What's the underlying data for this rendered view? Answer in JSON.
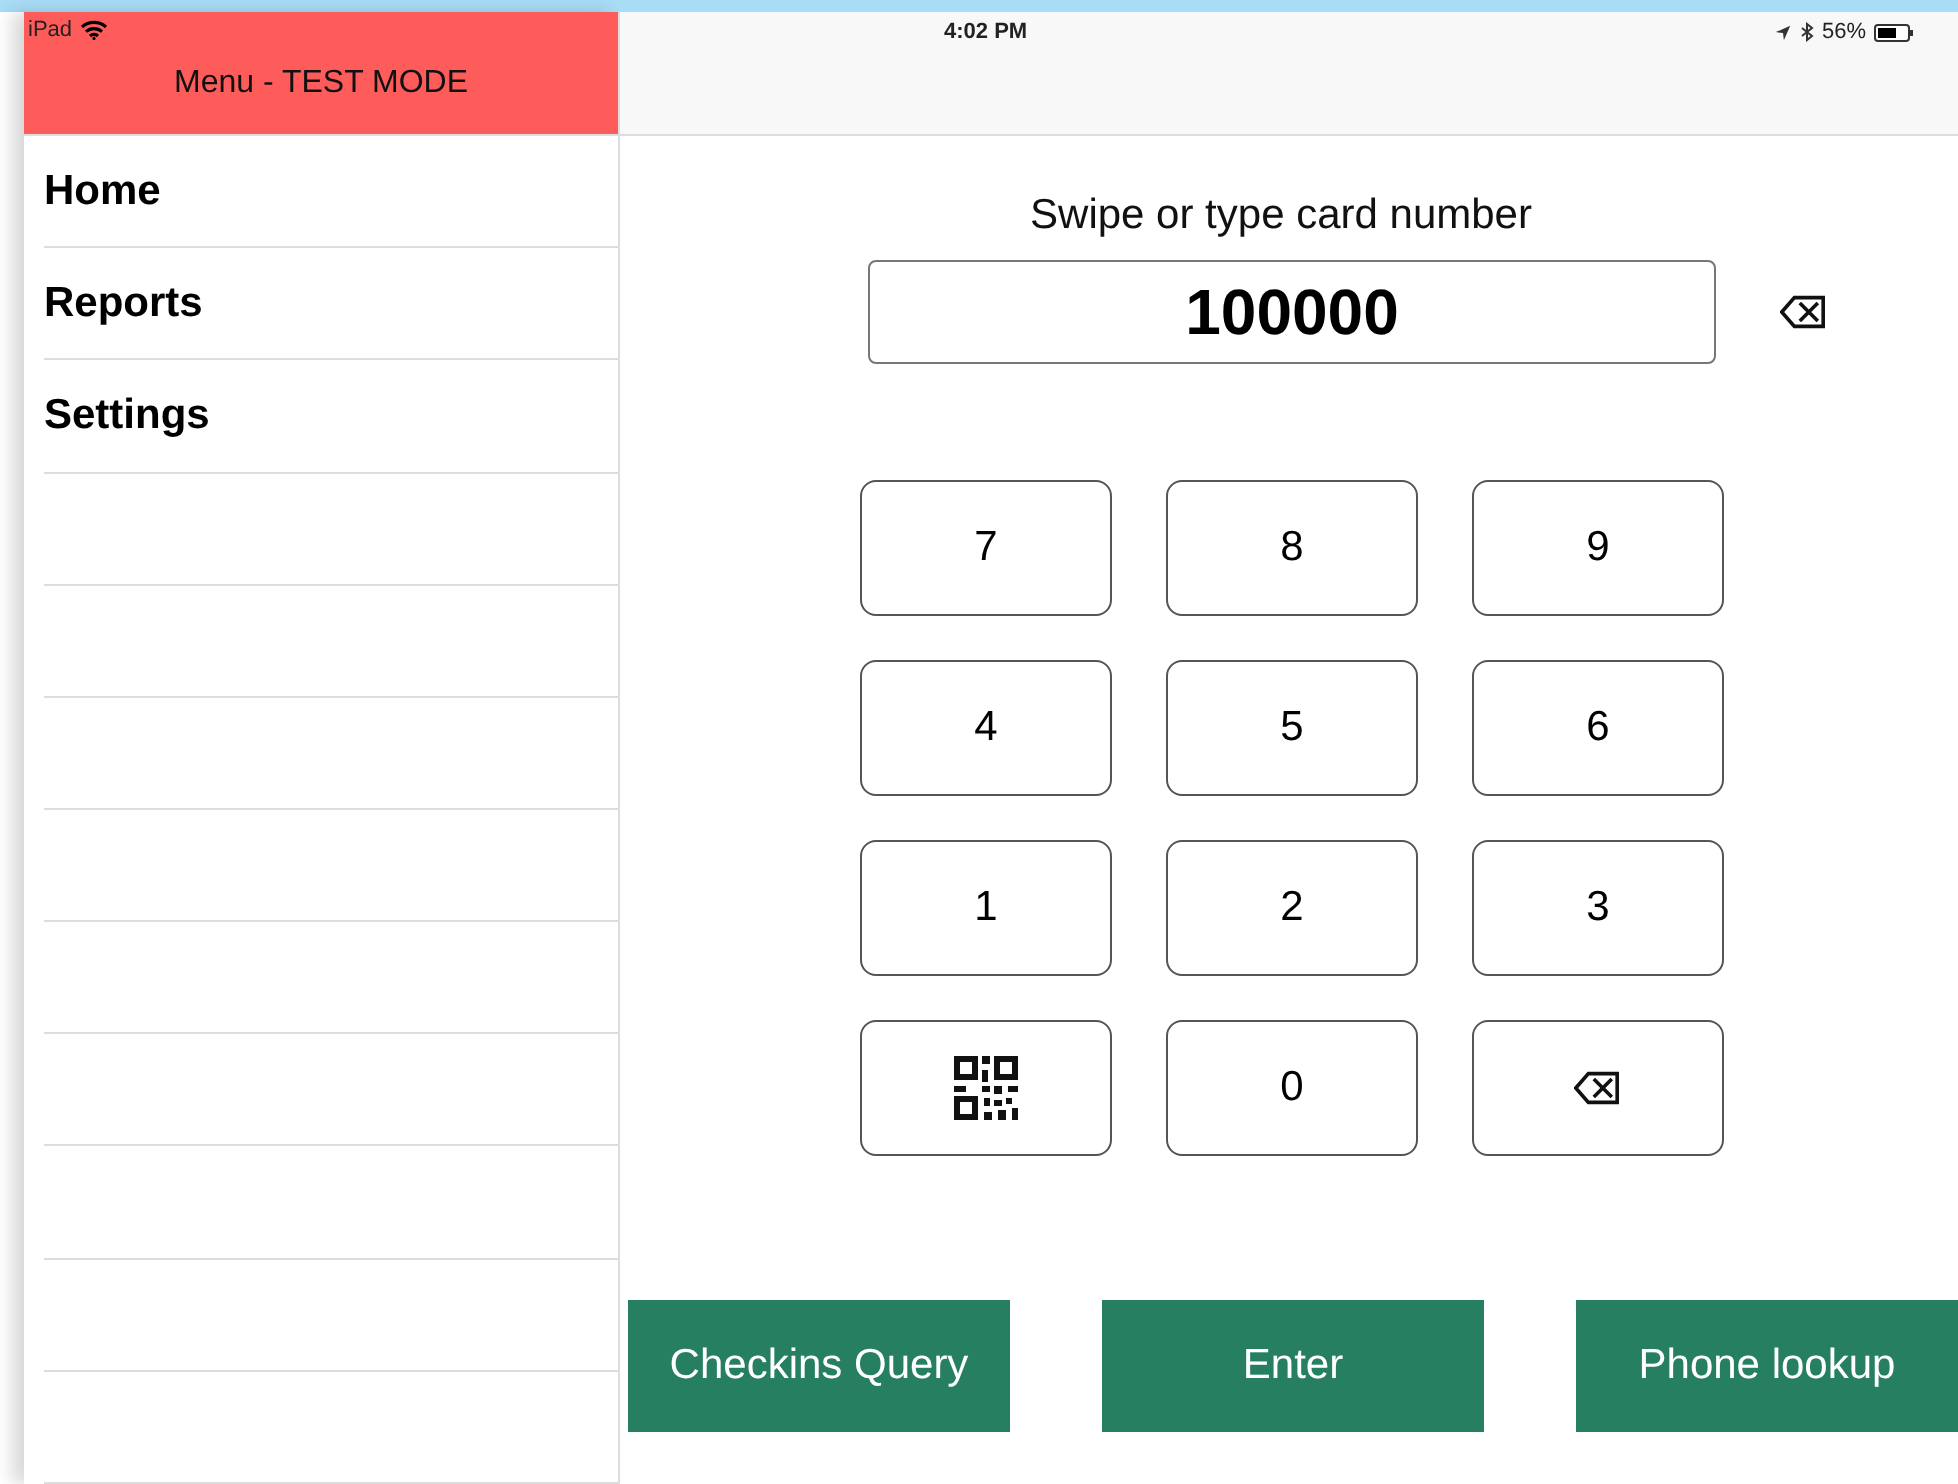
{
  "status_bar": {
    "device": "iPad",
    "time": "4:02 PM",
    "battery": "56%"
  },
  "sidebar": {
    "title": "Menu - TEST MODE",
    "items": [
      {
        "label": "Home"
      },
      {
        "label": "Reports"
      },
      {
        "label": "Settings"
      }
    ]
  },
  "prompt": "Swipe or type card number",
  "card_field": {
    "value": "100000"
  },
  "keypad": [
    {
      "kind": "digit",
      "label": "7"
    },
    {
      "kind": "digit",
      "label": "8"
    },
    {
      "kind": "digit",
      "label": "9"
    },
    {
      "kind": "digit",
      "label": "4"
    },
    {
      "kind": "digit",
      "label": "5"
    },
    {
      "kind": "digit",
      "label": "6"
    },
    {
      "kind": "digit",
      "label": "1"
    },
    {
      "kind": "digit",
      "label": "2"
    },
    {
      "kind": "digit",
      "label": "3"
    },
    {
      "kind": "qr"
    },
    {
      "kind": "digit",
      "label": "0"
    },
    {
      "kind": "backspace"
    }
  ],
  "actions": [
    "Checkins Query",
    "Enter",
    "Phone lookup"
  ]
}
